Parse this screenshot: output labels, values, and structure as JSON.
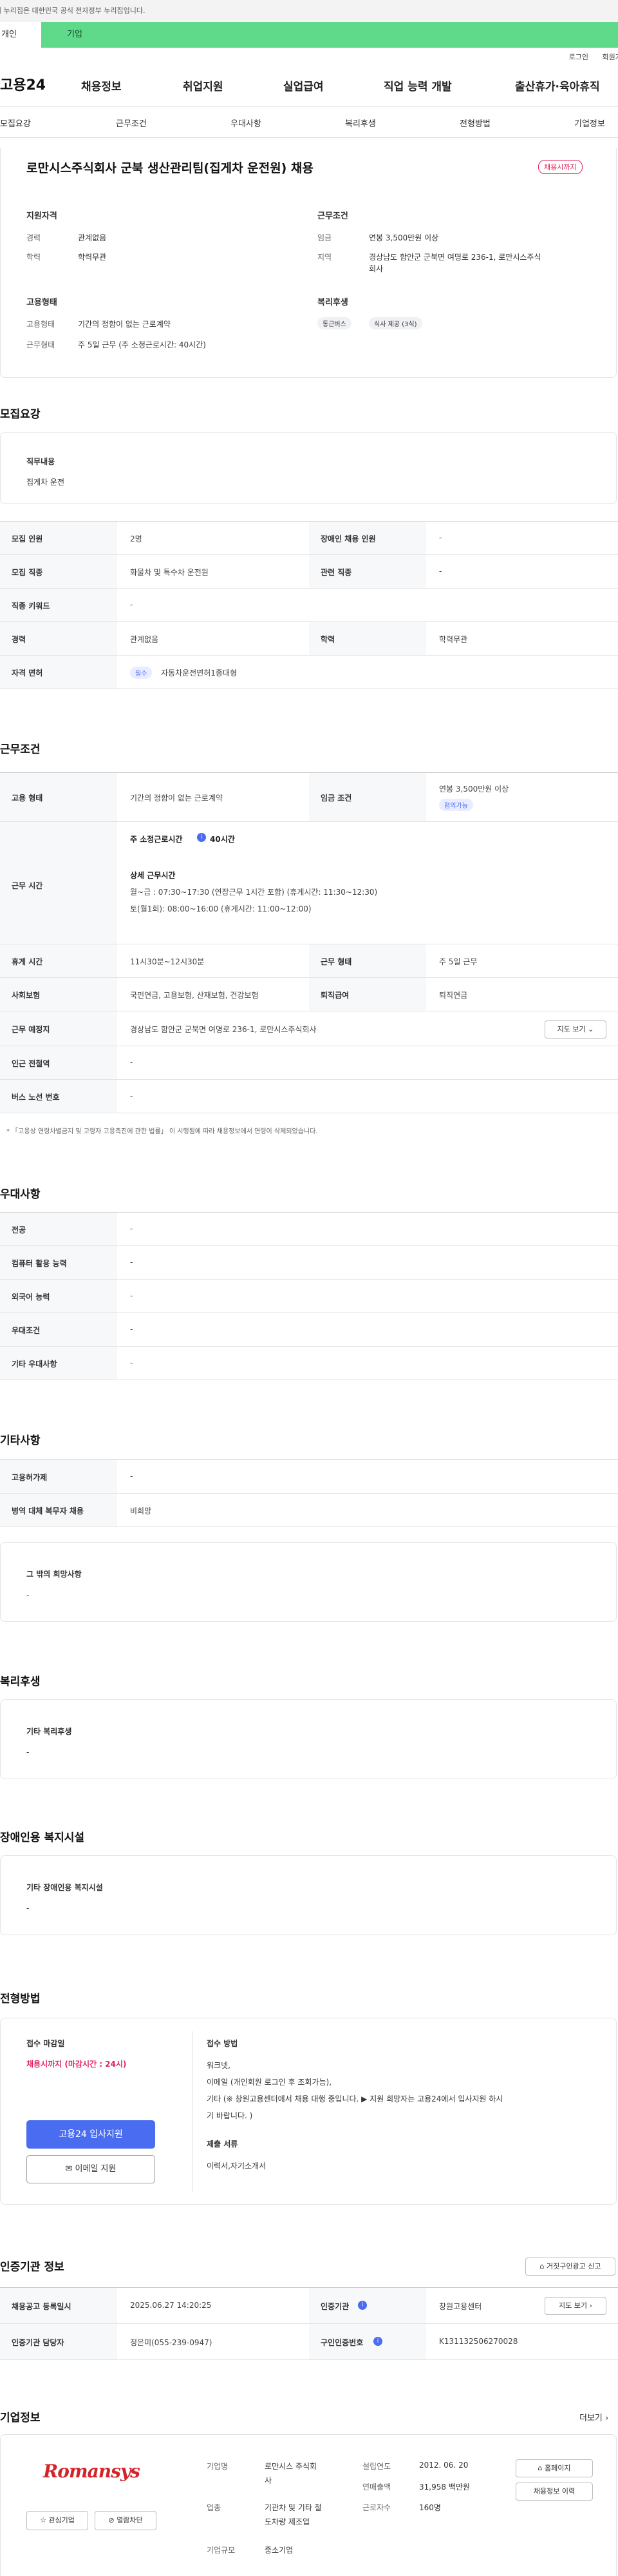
{
  "header": {
    "gov_notice": "이 누리집은 대한민국 공식 전자정부 누리집입니다.",
    "tab_personal": "개인",
    "tab_company": "기업",
    "util_login": "로그인",
    "util_join": "회원가입",
    "logo": "고용24",
    "menu": [
      "채용정보",
      "취업지원",
      "실업급여",
      "직업 능력 개발",
      "출산휴가·육아휴직"
    ],
    "subnav": [
      "모집요강",
      "근무조건",
      "우대사항",
      "복리후생",
      "전형방법",
      "기업정보"
    ]
  },
  "summary": {
    "title": "로만시스주식회사 군북 생산관리팀(집게차 운전원) 채용",
    "status_badge": "채용시까지",
    "qual_head": "지원자격",
    "career_label": "경력",
    "career_value": "관계없음",
    "edu_label": "학력",
    "edu_value": "학력무관",
    "cond_head": "근무조건",
    "wage_label": "임금",
    "wage_value": "연봉 3,500만원 이상",
    "region_label": "지역",
    "region_value_1": "경상남도 함안군 군북면 여명로 236-1, 로만시스주식",
    "region_value_2": "회사",
    "emp_head": "고용형태",
    "emp_type_label": "고용형태",
    "emp_type_value": "기간의 정함이 없는 근로계약",
    "work_type_label": "근무형태",
    "work_type_value": "주 5일 근무 (주 소정근로시간: 40시간)",
    "welfare_head": "복리후생",
    "welfare_tags": [
      "통근버스",
      "식사 제공 (3식)"
    ]
  },
  "recruit": {
    "head": "모집요강",
    "duty_label": "직무내용",
    "duty_value": "집게차 운전",
    "rows": [
      {
        "k1": "모집 인원",
        "v1": "2명",
        "k2": "장애인 채용 인원",
        "v2": "-"
      },
      {
        "k1": "모집 직종",
        "v1": "화물차 및 특수차 운전원",
        "k2": "관련 직종",
        "v2": "-"
      },
      {
        "k1": "직종 키워드",
        "v1": "-"
      },
      {
        "k1": "경력",
        "v1": "관계없음",
        "k2": "학력",
        "v2": "학력무관"
      },
      {
        "k1": "자격 면허",
        "badge": "필수",
        "v1": "자동차운전면허1종대형"
      }
    ]
  },
  "conditions": {
    "head": "근무조건",
    "emp_label": "고용 형태",
    "emp_value": "기간의 정함이 없는 근로계약",
    "wage_label": "임금 조건",
    "wage_value": "연봉 3,500만원 이상",
    "wage_badge": "협의가능",
    "hours_label": "근무 시간",
    "hours_title": "주 소정근로시간",
    "hours_value": "40시간",
    "hours_detail_title": "상세 근무시간",
    "hours_detail_1": "월~금 : 07:30~17:30 (연장근무 1시간 포함) (휴게시간: 11:30~12:30)",
    "hours_detail_2": "토(월1회): 08:00~16:00 (휴게시간: 11:00~12:00)",
    "rest_label": "휴게 시간",
    "rest_value": "11시30분~12시30분",
    "work_form_label": "근무 형태",
    "work_form_value": "주 5일 근무",
    "insurance_label": "사회보험",
    "insurance_value": "국민연금, 고용보험, 산재보험, 건강보험",
    "retire_label": "퇴직급여",
    "retire_value": "퇴직연금",
    "place_label": "근무 예정지",
    "place_value": "경상남도 함안군 군북면 여명로 236-1, 로만시스주식회사",
    "map_button": "지도 보기",
    "subway_label": "인근 전철역",
    "subway_value": "-",
    "bus_label": "버스 노선 번호",
    "bus_value": "-",
    "footnote": "* 「고용상 연령차별금지 및 고령자 고용촉진에 관한 법률」 이 시행됨에 따라 채용정보에서 연령이 삭제되었습니다."
  },
  "preference": {
    "head": "우대사항",
    "rows": [
      {
        "k": "전공",
        "v": "-"
      },
      {
        "k": "컴퓨터 활용 능력",
        "v": "-"
      },
      {
        "k": "외국어 능력",
        "v": "-"
      },
      {
        "k": "우대조건",
        "v": "-"
      },
      {
        "k": "기타 우대사항",
        "v": "-"
      }
    ]
  },
  "etc": {
    "head": "기타사항",
    "rows": [
      {
        "k": "고용허가제",
        "v": "-"
      },
      {
        "k": "병역 대체 복무자 채용",
        "v": "비희망"
      }
    ],
    "other_label": "그 밖의 희망사항",
    "other_value": "-"
  },
  "welfare": {
    "head": "복리후생",
    "label": "기타 복리후생",
    "value": "-"
  },
  "disability": {
    "head": "장애인용 복지시설",
    "label": "기타 장애인용 복지시설",
    "value": "-"
  },
  "screening": {
    "head": "전형방법",
    "deadline_label": "접수 마감일",
    "deadline_value": "채용시까지 (마감시간 : 24시)",
    "apply_button": "고용24 입사지원",
    "email_button": "이메일 지원",
    "method_label": "접수 방법",
    "method_1": "워크넷,",
    "method_2": "이메일 (개인회원 로그인 후 조회가능),",
    "method_3": "기타 (※ 창원고용센터에서 채용 대행 중입니다. ▶ 지원 희망자는 고용24에서 입사지원 하시",
    "method_4": "기 바랍니다. )",
    "docs_label": "제출 서류",
    "docs_value": "이력서,자기소개서"
  },
  "agency": {
    "head": "인증기관 정보",
    "report_button": "거짓구인광고 신고",
    "reg_label": "채용공고 등록일시",
    "reg_value": "2025.06.27 14:20:25",
    "cert_label": "인증기관",
    "cert_value": "창원고용센터",
    "map_button": "지도 보기",
    "manager_label": "인증기관 담당자",
    "manager_value": "정은미(055-239-0947)",
    "offer_label": "구인인증번호",
    "offer_value": "K131132506270028"
  },
  "company": {
    "head": "기업정보",
    "more": "더보기",
    "brand": "Romansys",
    "fav_button": "관심기업",
    "hide_button": "열람차단",
    "name_label": "기업명",
    "name_value_1": "로만시스 주식회",
    "name_value_2": "사",
    "industry_label": "업종",
    "industry_value_1": "기관차 및 기타 철",
    "industry_value_2": "도차량 제조업",
    "size_label": "기업규모",
    "size_value": "중소기업",
    "founded_label": "설립연도",
    "founded_value": "2012. 06. 20",
    "sales_label": "연매출액",
    "sales_value": "31,958 백만원",
    "staff_label": "근로자수",
    "staff_value": "160명",
    "homepage_button": "홈페이지",
    "history_button": "채용정보 이력"
  }
}
